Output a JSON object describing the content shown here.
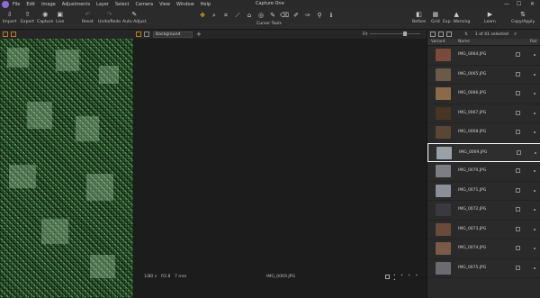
{
  "app": {
    "title": "Capture One",
    "menu": [
      "File",
      "Edit",
      "Image",
      "Adjustments",
      "Layer",
      "Select",
      "Camera",
      "View",
      "Window",
      "Help"
    ],
    "window_controls": [
      "—",
      "☐",
      "✕"
    ]
  },
  "toolbar": {
    "left": [
      {
        "label": "Import",
        "icon": "import-icon",
        "glyph": "⇩"
      },
      {
        "label": "Export",
        "icon": "export-icon",
        "glyph": "⇧"
      },
      {
        "label": "Capture",
        "icon": "camera-icon",
        "glyph": "◉"
      },
      {
        "label": "Live",
        "icon": "live-icon",
        "glyph": "▣"
      },
      {
        "label": "Reset",
        "icon": "reset-icon",
        "glyph": "↶"
      },
      {
        "label": "Undo/Redo",
        "icon": "undo-redo-icon",
        "glyph": "↷"
      },
      {
        "label": "Auto Adjust",
        "icon": "auto-adjust-icon",
        "glyph": "✎"
      }
    ],
    "cursor_tools_label": "Cursor Tools",
    "cursor_tools": [
      "pan-icon",
      "loupe-icon",
      "crop-icon",
      "straighten-icon",
      "keystone-icon",
      "spot-icon",
      "brush-icon",
      "eraser-icon",
      "picker-icon",
      "annotate-icon",
      "pipette-icon",
      "info-icon"
    ],
    "right": [
      {
        "label": "Before",
        "icon": "before-icon",
        "glyph": "◧"
      },
      {
        "label": "Grid",
        "icon": "grid-icon",
        "glyph": "▦"
      },
      {
        "label": "Exp. Warning",
        "icon": "exposure-warning-icon",
        "glyph": "▲"
      },
      {
        "label": "Learn",
        "icon": "learn-icon",
        "glyph": "▶"
      },
      {
        "label": "Copy/Apply",
        "icon": "copy-apply-icon",
        "glyph": "⇅"
      }
    ]
  },
  "viewer": {
    "layer_select": "Background",
    "add_label": "+",
    "fit_label": "Fit",
    "status": {
      "iso": "1/80 s",
      "aperture": "f/2.8",
      "focal": "7 mm",
      "filename": "IMG_0069.JPG",
      "dots": "• • • • •"
    }
  },
  "browser": {
    "count": "1 of 41 selected",
    "columns": {
      "variant": "Variant",
      "name": "Name",
      "rating": "Rat"
    },
    "files": [
      {
        "name": "IMG_0064.JPG",
        "color": "#7a4a3a"
      },
      {
        "name": "IMG_0065.JPG",
        "color": "#6b5a48"
      },
      {
        "name": "IMG_0066.JPG",
        "color": "#8b6a4a"
      },
      {
        "name": "IMG_0067.JPG",
        "color": "#4a3424"
      },
      {
        "name": "IMG_0068.JPG",
        "color": "#5a4634"
      },
      {
        "name": "IMG_0069.JPG",
        "color": "#9aa0a8",
        "selected": true
      },
      {
        "name": "IMG_0070.JPG",
        "color": "#7d7d84"
      },
      {
        "name": "IMG_0071.JPG",
        "color": "#8a8f98"
      },
      {
        "name": "IMG_0072.JPG",
        "color": "#3a3a3e"
      },
      {
        "name": "IMG_0073.JPG",
        "color": "#6a4a3a"
      },
      {
        "name": "IMG_0074.JPG",
        "color": "#7a5a48"
      },
      {
        "name": "IMG_0075.JPG",
        "color": "#6b6b70"
      }
    ]
  }
}
